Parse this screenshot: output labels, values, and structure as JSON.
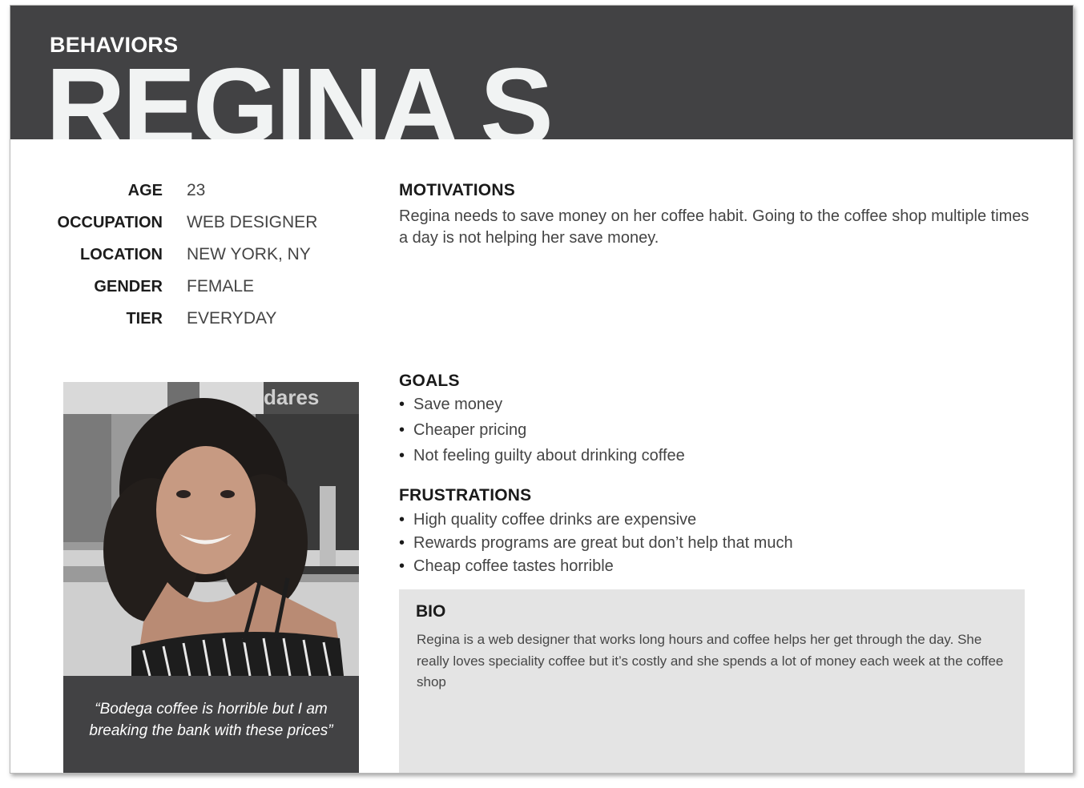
{
  "header": {
    "kicker": "BEHAVIORS",
    "name": "REGINA S",
    "background_color": "#424244",
    "name_color": "#f1f3f3"
  },
  "facts": [
    {
      "label": "AGE",
      "value": "23"
    },
    {
      "label": "OCCUPATION",
      "value": "WEB DESIGNER"
    },
    {
      "label": "LOCATION",
      "value": "NEW YORK, NY"
    },
    {
      "label": "GENDER",
      "value": "FEMALE"
    },
    {
      "label": "TIER",
      "value": "EVERYDAY"
    }
  ],
  "photo": {
    "quote": "“Bodega coffee is horrible but I am breaking the bank with these prices”",
    "storefront_sign": "dares"
  },
  "motivations": {
    "title": "MOTIVATIONS",
    "text": "Regina needs to save money on her coffee habit. Going to the coffee shop multiple times a day is not helping her save money."
  },
  "goals": {
    "title": "GOALS",
    "items": [
      "Save money",
      "Cheaper pricing",
      "Not feeling guilty about drinking coffee"
    ]
  },
  "frustrations": {
    "title": "FRUSTRATIONS",
    "items": [
      "High quality coffee drinks are expensive",
      "Rewards programs are great but don’t help that much",
      "Cheap coffee tastes horrible"
    ]
  },
  "bio": {
    "title": "BIO",
    "text": "Regina is a web designer that works long hours and coffee helps her get through the day. She really loves speciality coffee but it’s costly and she spends a lot of money each week at the coffee shop",
    "background_color": "#e4e4e4"
  }
}
